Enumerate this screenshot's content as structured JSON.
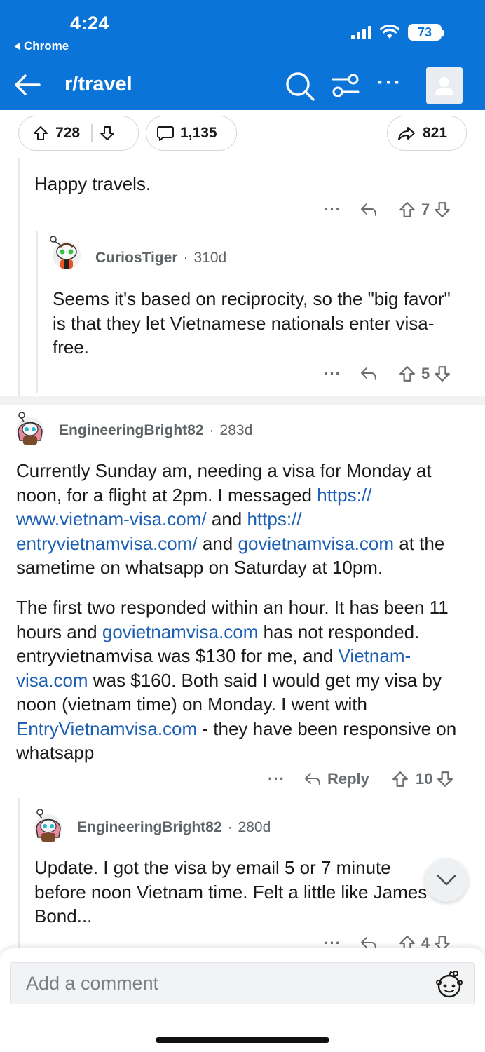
{
  "status": {
    "time": "4:24",
    "back_app": "Chrome",
    "battery": "73"
  },
  "appbar": {
    "title": "r/travel"
  },
  "post_actions": {
    "upvotes": "728",
    "comments": "1,135",
    "shares": "821"
  },
  "comments": [
    {
      "body_lines": [
        "Happy travels."
      ],
      "score": "7"
    },
    {
      "user": "CuriosTiger",
      "age": "310d",
      "body": "Seems it's based on reciprocity, so the \"big favor\" is that they let Vietnamese nationals enter visa-free.",
      "score": "5"
    },
    {
      "user": "EngineeringBright82",
      "age": "283d",
      "para1": {
        "t1": "Currently Sunday am, needing a visa for Monday at noon, for a flight at 2pm. I messaged ",
        "link1": "https:// www.vietnam-visa.com/",
        "t2": " and ",
        "link2": "https:// entryvietnamvisa.com/",
        "t3": " and ",
        "link3": "govietnamvisa.com",
        "t4": " at the sametime on whatsapp on Saturday at 10pm."
      },
      "para2": {
        "t1": "The first two responded within an hour. It has been 11 hours and ",
        "link1": "govietnamvisa.com",
        "t2": " has not responded. entryvietnamvisa was $130 for me, and ",
        "link2": "Vietnam-visa.com",
        "t3": " was $160. Both said I would get my visa by noon (vietnam time) on Monday. I went with ",
        "link3": "EntryVietnamvisa.com",
        "t4": " - they have been responsive on whatsapp"
      },
      "reply_label": "Reply",
      "score": "10"
    },
    {
      "user": "EngineeringBright82",
      "age": "280d",
      "body": "Update. I got the visa by email 5 or 7 minute before noon Vietnam time. Felt a little like James Bond...",
      "score": "4"
    }
  ],
  "composer": {
    "placeholder": "Add a comment"
  }
}
